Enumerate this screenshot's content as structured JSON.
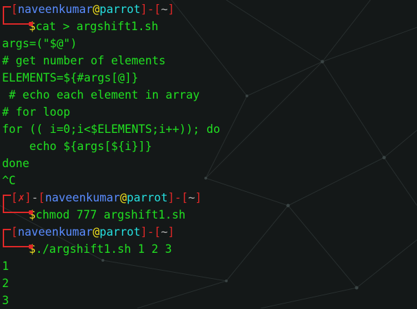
{
  "prompt": {
    "user": "naveenkumar",
    "at": "@",
    "host": "parrot",
    "sep": "]-[",
    "dir": "~",
    "open": "[",
    "close": "]",
    "fail_mark": "✗",
    "dash": "-",
    "dollar": "$"
  },
  "commands": {
    "cmd1": "cat > argshift1.sh",
    "cmd2": "chmod 777 argshift1.sh",
    "cmd3": "./argshift1.sh 1 2 3"
  },
  "script_lines": [
    "args=(\"$@\")",
    "# get number of elements",
    "ELEMENTS=${#args[@]}",
    " # echo each element in array",
    "# for loop",
    "for (( i=0;i<$ELEMENTS;i++)); do",
    "    echo ${args[${i}]}",
    "done",
    "^C"
  ],
  "output_lines": [
    "1",
    "2",
    "3"
  ]
}
